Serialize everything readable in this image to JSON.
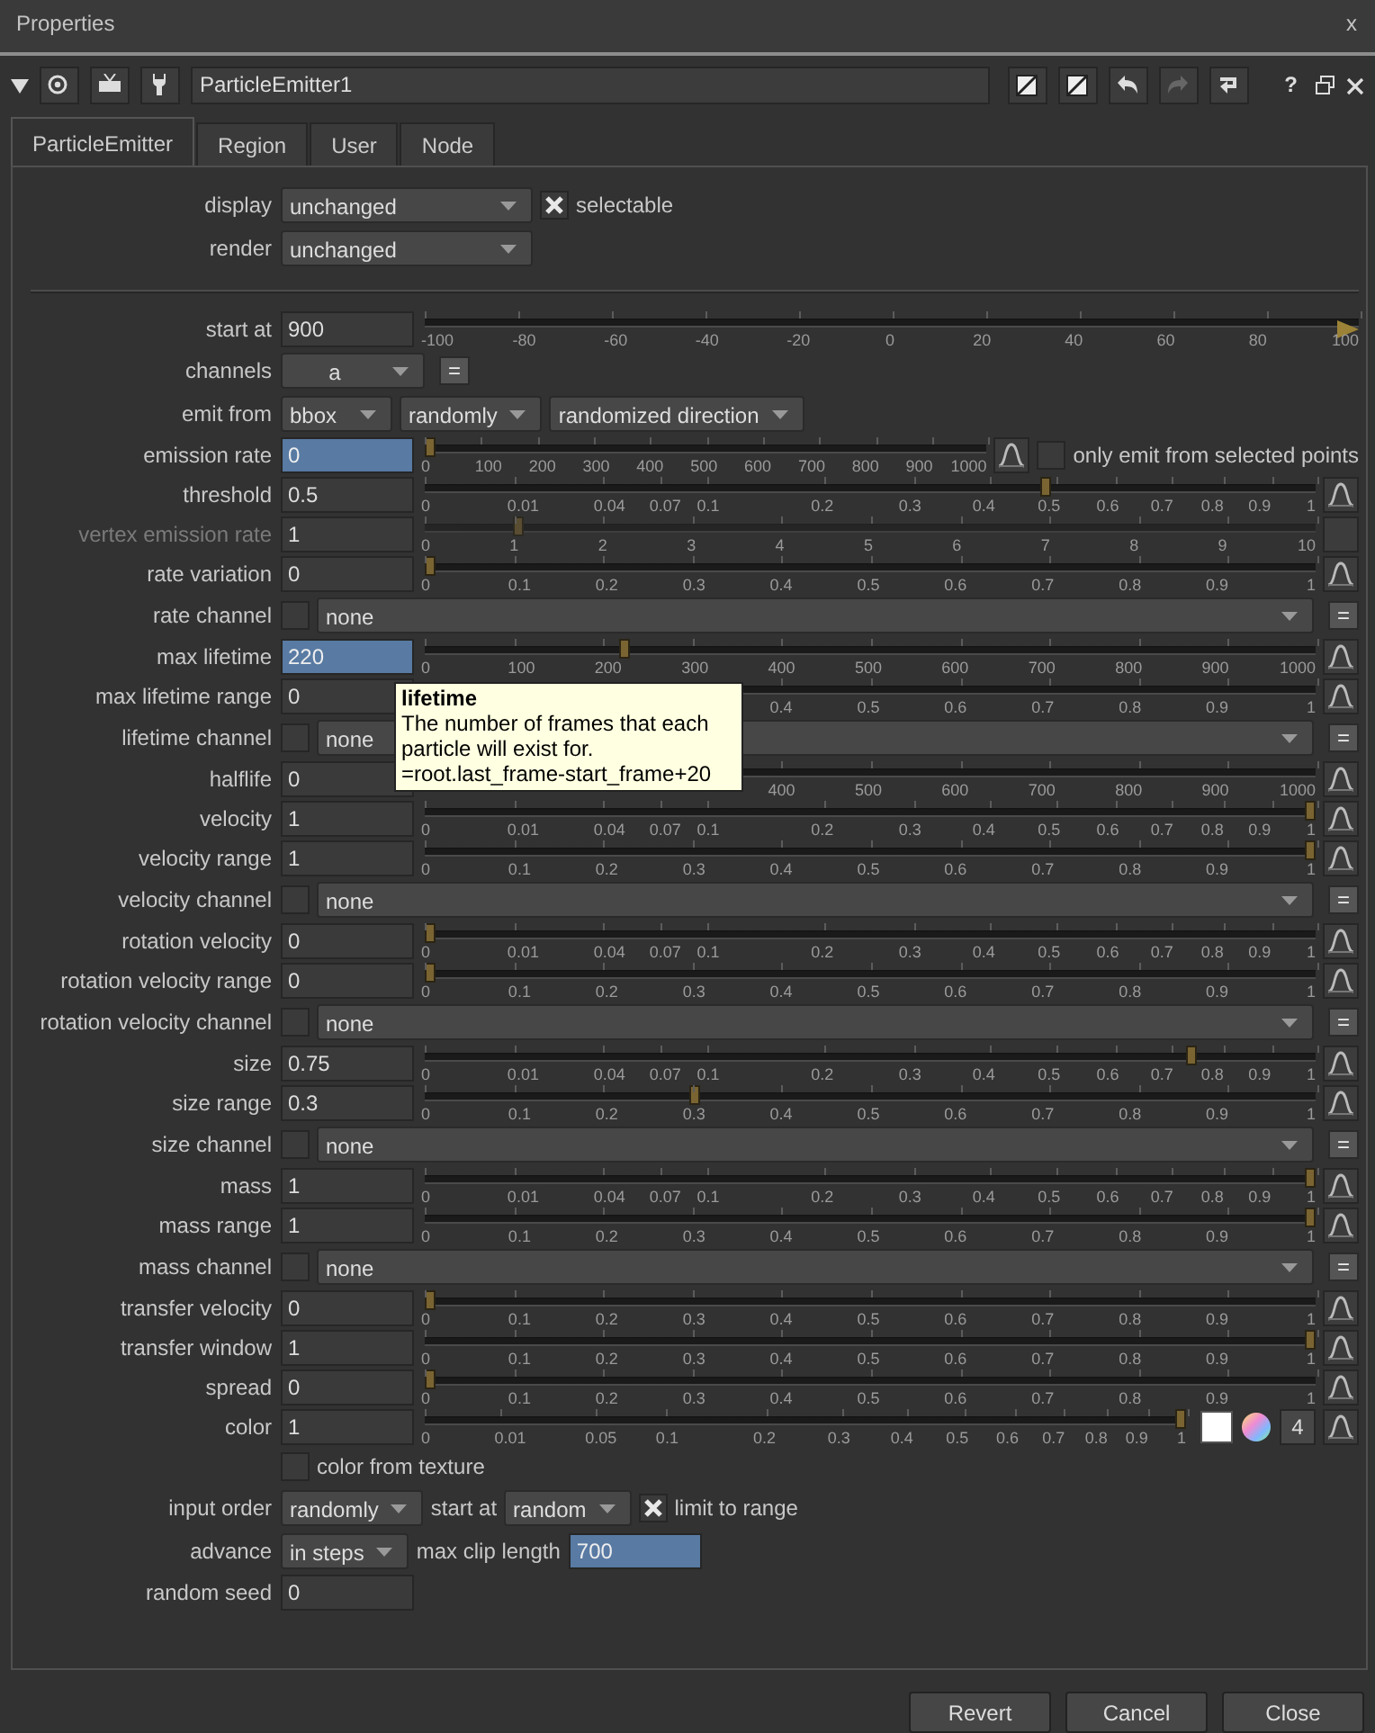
{
  "window": {
    "title": "Properties",
    "close_label": "x"
  },
  "toolbar": {
    "node_name": "ParticleEmitter1",
    "help_label": "?"
  },
  "tabs": [
    {
      "label": "ParticleEmitter",
      "selected": true
    },
    {
      "label": "Region",
      "selected": false
    },
    {
      "label": "User",
      "selected": false
    },
    {
      "label": "Node",
      "selected": false
    }
  ],
  "rows": [
    {
      "kind": "row",
      "label": "display",
      "controls": [
        {
          "kind": "menu_long",
          "value": "unchanged"
        },
        {
          "kind": "checkbox",
          "checked": true,
          "label": "selectable"
        }
      ]
    },
    {
      "kind": "row",
      "label": "render",
      "controls": [
        {
          "kind": "menu_long",
          "value": "unchanged"
        }
      ]
    },
    {
      "kind": "divider"
    },
    {
      "kind": "row",
      "label": "start at",
      "controls": [
        {
          "kind": "field",
          "value": "900",
          "highlighted": false
        },
        {
          "kind": "slider_hundred",
          "level": 1,
          "out_of_range": true,
          "ticks": [
            "-100",
            "-80",
            "-60",
            "-40",
            "-20",
            "0",
            "20",
            "40",
            "60",
            "80",
            "100"
          ]
        }
      ]
    },
    {
      "kind": "row",
      "label": "channels",
      "controls": [
        {
          "kind": "menu_mid",
          "value": "a"
        },
        {
          "kind": "equals",
          "label": "="
        }
      ]
    },
    {
      "kind": "row",
      "label": "emit from",
      "controls": [
        {
          "kind": "menu",
          "value": "bbox"
        },
        {
          "kind": "menu",
          "value": "randomly"
        },
        {
          "kind": "menu",
          "value": "randomized direction"
        }
      ]
    },
    {
      "kind": "row",
      "label": "emission rate",
      "controls": [
        {
          "kind": "field",
          "value": "0",
          "highlighted": true
        },
        {
          "kind": "slider_thousand",
          "level": 0,
          "ticks": [
            "0",
            "100",
            "200",
            "300",
            "400",
            "500",
            "600",
            "700",
            "800",
            "900",
            "1000"
          ]
        },
        {
          "kind": "curve"
        },
        {
          "kind": "checkbox",
          "checked": false,
          "label": "only emit from selected points"
        }
      ]
    },
    {
      "kind": "row",
      "label": "threshold",
      "controls": [
        {
          "kind": "field",
          "value": "0.5",
          "highlighted": false
        },
        {
          "kind": "slider_unit_sqrt",
          "level": 0.7,
          "ticks": [
            "0",
            "0.01",
            "0.04",
            "0.07",
            "0.1",
            "0.2",
            "0.3",
            "0.4",
            "0.5",
            "0.6",
            "0.7",
            "0.8",
            "0.9",
            "1"
          ]
        },
        {
          "kind": "curve"
        }
      ]
    },
    {
      "kind": "row",
      "label": "vertex emission rate",
      "disabled": true,
      "controls": [
        {
          "kind": "field",
          "value": "1",
          "highlighted": false
        },
        {
          "kind": "slider_ten",
          "level": 0.1,
          "ticks": [
            "0",
            "1",
            "2",
            "3",
            "4",
            "5",
            "6",
            "7",
            "8",
            "9",
            "10"
          ]
        },
        {
          "kind": "curve"
        }
      ]
    },
    {
      "kind": "row",
      "label": "rate variation",
      "controls": [
        {
          "kind": "field",
          "value": "0",
          "highlighted": false
        },
        {
          "kind": "slider_unit",
          "level": 0,
          "ticks": [
            "0",
            "0.1",
            "0.2",
            "0.3",
            "0.4",
            "0.5",
            "0.6",
            "0.7",
            "0.8",
            "0.9",
            "1"
          ]
        },
        {
          "kind": "curve"
        }
      ]
    },
    {
      "kind": "row",
      "label": "rate channel",
      "controls": [
        {
          "kind": "checkbox",
          "checked": false
        },
        {
          "kind": "menu_fill",
          "value": "none"
        },
        {
          "kind": "equals",
          "label": "="
        }
      ]
    },
    {
      "kind": "row",
      "label": "max lifetime",
      "tooltip": {
        "title": "lifetime",
        "text": "The number of frames that each particle will exist for.",
        "expression": "=root.last_frame-start_frame+20"
      },
      "controls": [
        {
          "kind": "field",
          "value": "220",
          "highlighted": true
        },
        {
          "kind": "slider_thousand",
          "level": 0.22,
          "ticks": [
            "0",
            "100",
            "200",
            "300",
            "400",
            "500",
            "600",
            "700",
            "800",
            "900",
            "1000"
          ]
        },
        {
          "kind": "curve"
        }
      ]
    },
    {
      "kind": "row",
      "label": "max lifetime range",
      "controls": [
        {
          "kind": "field",
          "value": "0",
          "highlighted": false
        },
        {
          "kind": "slider_unit",
          "ticks": [
            "0.4",
            "0.5",
            "0.6",
            "0.7",
            "0.8",
            "0.9",
            "1"
          ]
        },
        {
          "kind": "curve"
        }
      ]
    },
    {
      "kind": "row",
      "label": "lifetime channel",
      "controls": [
        {
          "kind": "checkbox",
          "checked": false
        },
        {
          "kind": "menu_fill",
          "value": "none"
        },
        {
          "kind": "equals",
          "label": "="
        }
      ]
    },
    {
      "kind": "row",
      "label": "halflife",
      "controls": [
        {
          "kind": "field",
          "value": "0",
          "highlighted": false
        },
        {
          "kind": "slider_thousand",
          "ticks": [
            "400",
            "500",
            "600",
            "700",
            "800",
            "900",
            "1000"
          ]
        },
        {
          "kind": "curve"
        }
      ]
    },
    {
      "kind": "row",
      "label": "velocity",
      "controls": [
        {
          "kind": "field",
          "value": "1",
          "highlighted": false
        },
        {
          "kind": "slider_unit_sqrt",
          "level": 1,
          "ticks": [
            "0",
            "0.01",
            "0.04",
            "0.07",
            "0.1",
            "0.2",
            "0.3",
            "0.4",
            "0.5",
            "0.6",
            "0.7",
            "0.8",
            "0.9",
            "1"
          ]
        },
        {
          "kind": "curve"
        }
      ]
    },
    {
      "kind": "row",
      "label": "velocity range",
      "controls": [
        {
          "kind": "field",
          "value": "1",
          "highlighted": false
        },
        {
          "kind": "slider_unit",
          "level": 1,
          "ticks": [
            "0",
            "0.1",
            "0.2",
            "0.3",
            "0.4",
            "0.5",
            "0.6",
            "0.7",
            "0.8",
            "0.9",
            "1"
          ]
        },
        {
          "kind": "curve"
        }
      ]
    },
    {
      "kind": "row",
      "label": "velocity channel",
      "controls": [
        {
          "kind": "checkbox",
          "checked": false
        },
        {
          "kind": "menu_fill",
          "value": "none"
        },
        {
          "kind": "equals",
          "label": "="
        }
      ]
    },
    {
      "kind": "row",
      "label": "rotation velocity",
      "controls": [
        {
          "kind": "field",
          "value": "0",
          "highlighted": false
        },
        {
          "kind": "slider_unit_sqrt",
          "level": 0,
          "ticks": [
            "0",
            "0.01",
            "0.04",
            "0.07",
            "0.1",
            "0.2",
            "0.3",
            "0.4",
            "0.5",
            "0.6",
            "0.7",
            "0.8",
            "0.9",
            "1"
          ]
        },
        {
          "kind": "curve"
        }
      ]
    },
    {
      "kind": "row",
      "label": "rotation velocity range",
      "controls": [
        {
          "kind": "field",
          "value": "0",
          "highlighted": false
        },
        {
          "kind": "slider_unit",
          "level": 0,
          "ticks": [
            "0",
            "0.1",
            "0.2",
            "0.3",
            "0.4",
            "0.5",
            "0.6",
            "0.7",
            "0.8",
            "0.9",
            "1"
          ]
        },
        {
          "kind": "curve"
        }
      ]
    },
    {
      "kind": "row",
      "label": "rotation velocity channel",
      "controls": [
        {
          "kind": "checkbox",
          "checked": false
        },
        {
          "kind": "menu_fill",
          "value": "none"
        },
        {
          "kind": "equals",
          "label": "="
        }
      ]
    },
    {
      "kind": "row",
      "label": "size",
      "controls": [
        {
          "kind": "field",
          "value": "0.75",
          "highlighted": false
        },
        {
          "kind": "slider_unit_sqrt",
          "level": 0.866,
          "ticks": [
            "0",
            "0.01",
            "0.04",
            "0.07",
            "0.1",
            "0.2",
            "0.3",
            "0.4",
            "0.5",
            "0.6",
            "0.7",
            "0.8",
            "0.9",
            "1"
          ]
        },
        {
          "kind": "curve"
        }
      ]
    },
    {
      "kind": "row",
      "label": "size range",
      "controls": [
        {
          "kind": "field",
          "value": "0.3",
          "highlighted": false
        },
        {
          "kind": "slider_unit",
          "level": 0.3,
          "ticks": [
            "0",
            "0.1",
            "0.2",
            "0.3",
            "0.4",
            "0.5",
            "0.6",
            "0.7",
            "0.8",
            "0.9",
            "1"
          ]
        },
        {
          "kind": "curve"
        }
      ]
    },
    {
      "kind": "row",
      "label": "size channel",
      "controls": [
        {
          "kind": "checkbox",
          "checked": false
        },
        {
          "kind": "menu_fill",
          "value": "none"
        },
        {
          "kind": "equals",
          "label": "="
        }
      ]
    },
    {
      "kind": "row",
      "label": "mass",
      "controls": [
        {
          "kind": "field",
          "value": "1",
          "highlighted": false
        },
        {
          "kind": "slider_unit_sqrt",
          "level": 1,
          "ticks": [
            "0",
            "0.01",
            "0.04",
            "0.07",
            "0.1",
            "0.2",
            "0.3",
            "0.4",
            "0.5",
            "0.6",
            "0.7",
            "0.8",
            "0.9",
            "1"
          ]
        },
        {
          "kind": "curve"
        }
      ]
    },
    {
      "kind": "row",
      "label": "mass range",
      "controls": [
        {
          "kind": "field",
          "value": "1",
          "highlighted": false
        },
        {
          "kind": "slider_unit",
          "level": 1,
          "ticks": [
            "0",
            "0.1",
            "0.2",
            "0.3",
            "0.4",
            "0.5",
            "0.6",
            "0.7",
            "0.8",
            "0.9",
            "1"
          ]
        },
        {
          "kind": "curve"
        }
      ]
    },
    {
      "kind": "row",
      "label": "mass channel",
      "controls": [
        {
          "kind": "checkbox",
          "checked": false
        },
        {
          "kind": "menu_fill",
          "value": "none"
        },
        {
          "kind": "equals",
          "label": "="
        }
      ]
    },
    {
      "kind": "row",
      "label": "transfer velocity",
      "controls": [
        {
          "kind": "field",
          "value": "0",
          "highlighted": false
        },
        {
          "kind": "slider_unit",
          "level": 0,
          "ticks": [
            "0",
            "0.1",
            "0.2",
            "0.3",
            "0.4",
            "0.5",
            "0.6",
            "0.7",
            "0.8",
            "0.9",
            "1"
          ]
        },
        {
          "kind": "curve"
        }
      ]
    },
    {
      "kind": "row",
      "label": "transfer window",
      "controls": [
        {
          "kind": "field",
          "value": "1",
          "highlighted": false
        },
        {
          "kind": "slider_unit",
          "level": 1,
          "ticks": [
            "0",
            "0.1",
            "0.2",
            "0.3",
            "0.4",
            "0.5",
            "0.6",
            "0.7",
            "0.8",
            "0.9",
            "1"
          ]
        },
        {
          "kind": "curve"
        }
      ]
    },
    {
      "kind": "row",
      "label": "spread",
      "controls": [
        {
          "kind": "field",
          "value": "0",
          "highlighted": false
        },
        {
          "kind": "slider_unit",
          "level": 0,
          "ticks": [
            "0",
            "0.1",
            "0.2",
            "0.3",
            "0.4",
            "0.5",
            "0.6",
            "0.7",
            "0.8",
            "0.9",
            "1"
          ]
        },
        {
          "kind": "curve"
        }
      ]
    },
    {
      "kind": "row",
      "label": "color",
      "controls": [
        {
          "kind": "field",
          "value": "1",
          "highlighted": false
        },
        {
          "kind": "slider_unit_sqrt",
          "level": 1,
          "ticks": [
            "0",
            "0.01",
            "0.05",
            "0.1",
            "0.2",
            "0.3",
            "0.4",
            "0.5",
            "0.6",
            "0.7",
            "0.8",
            "0.9",
            "1"
          ]
        },
        {
          "kind": "swatch"
        },
        {
          "kind": "wheel"
        },
        {
          "kind": "count",
          "label": "4"
        },
        {
          "kind": "curve"
        }
      ]
    },
    {
      "kind": "row",
      "controls": [
        {
          "kind": "checkbox",
          "checked": false,
          "label": "color from texture"
        }
      ]
    },
    {
      "kind": "row",
      "label": "input order",
      "controls": [
        {
          "kind": "menu",
          "value": "randomly"
        },
        {
          "kind": "text",
          "text": "start at"
        },
        {
          "kind": "menu",
          "value": "random"
        },
        {
          "kind": "checkbox",
          "checked": true,
          "label": "limit to range"
        }
      ]
    },
    {
      "kind": "row",
      "label": "advance",
      "controls": [
        {
          "kind": "menu",
          "value": "in steps"
        },
        {
          "kind": "text",
          "text": "max clip length"
        },
        {
          "kind": "field",
          "value": "700",
          "highlighted": true
        }
      ]
    },
    {
      "kind": "row",
      "label": "random seed",
      "controls": [
        {
          "kind": "field",
          "value": "0",
          "highlighted": false
        }
      ]
    }
  ],
  "footer": [
    {
      "label": "Revert"
    },
    {
      "label": "Cancel"
    },
    {
      "label": "Close"
    }
  ]
}
